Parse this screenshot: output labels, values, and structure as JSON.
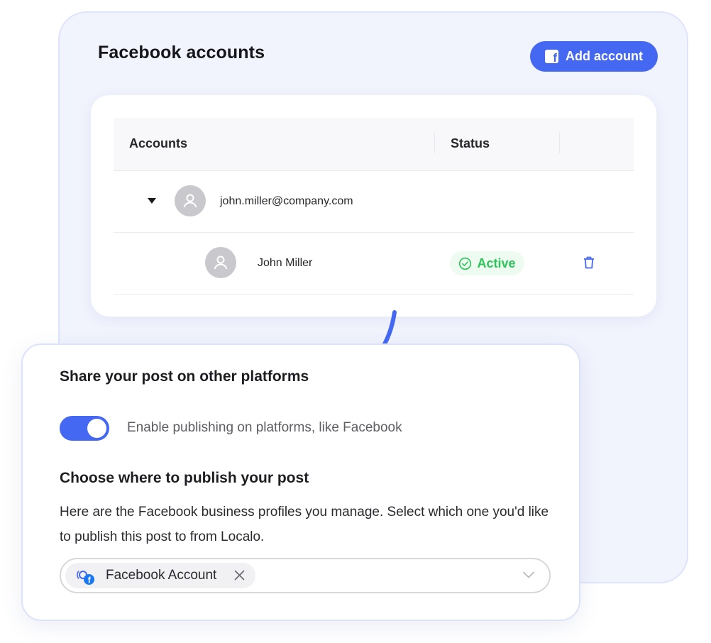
{
  "accounts_panel": {
    "title": "Facebook accounts",
    "add_button_label": "Add account",
    "table": {
      "columns": [
        "Accounts",
        "Status"
      ],
      "parent_account": {
        "email": "john.miller@company.com"
      },
      "child_account": {
        "name": "John Miller",
        "status": "Active"
      }
    }
  },
  "share_panel": {
    "title": "Share your post on other platforms",
    "toggle": {
      "enabled": true,
      "label": "Enable publishing on platforms, like Facebook"
    },
    "choose_title": "Choose where to publish your post",
    "description": "Here are the Facebook business profiles you manage. Select which one you'd like to publish this post to from Localo.",
    "select": {
      "selected_chip": "Facebook Account"
    }
  },
  "colors": {
    "accent": "#4468f2",
    "active_green": "#2dc55a",
    "back_card_bg": "#f1f3fd"
  },
  "icons": {
    "add_button": "facebook-icon",
    "avatar": "user-icon",
    "status": "check-circle-icon",
    "delete": "trash-icon",
    "expand": "caret-down-icon",
    "chip": "facebook-icon",
    "chip_remove": "close-icon",
    "select_open": "chevron-down-icon",
    "connector": "arrow-icon"
  }
}
